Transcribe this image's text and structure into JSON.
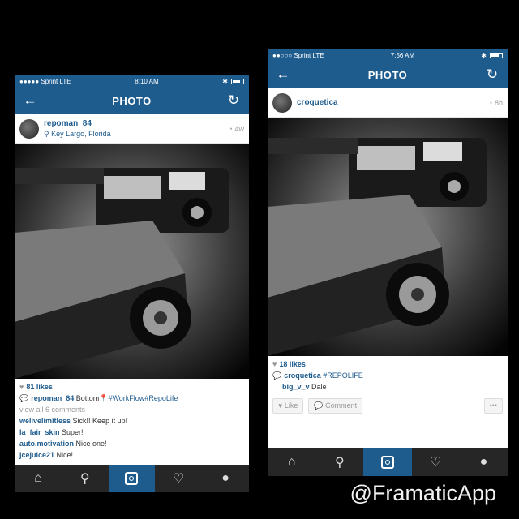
{
  "left": {
    "status": {
      "carrier": "●●●●● Sprint  LTE",
      "time": "8:10 AM",
      "bt": "✱"
    },
    "nav": {
      "title": "PHOTO",
      "back": "←",
      "refresh": "↻"
    },
    "post": {
      "username": "repoman_84",
      "location": "⚲ Key Largo, Florida",
      "time": "◔ 4w"
    },
    "likes": "81 likes",
    "caption": {
      "user": "repoman_84",
      "text": " Bottom📍",
      "tags": "#WorkFlow#RepoLife"
    },
    "view_all": "view all 6 comments",
    "comments": [
      {
        "user": "welivelimitless",
        "text": " Sick!! Keep it up!"
      },
      {
        "user": "la_fair_skin",
        "text": " Super!"
      },
      {
        "user": "auto.motivation",
        "text": " Nice one!"
      },
      {
        "user": "jcejuice21",
        "text": " Nice!"
      }
    ]
  },
  "right": {
    "status": {
      "carrier": "●●○○○ Sprint  LTE",
      "time": "7:56 AM",
      "bt": "✱"
    },
    "nav": {
      "title": "PHOTO",
      "back": "←",
      "refresh": "↻"
    },
    "post": {
      "username": "croquetica",
      "time": "◔ 8h"
    },
    "likes": "18 likes",
    "caption": {
      "user": "croquetica",
      "tags": " #REPOLIFE"
    },
    "comments": [
      {
        "user": "big_v_v",
        "text": " Dale"
      }
    ],
    "actions": {
      "like": "♥ Like",
      "comment": "💬 Comment",
      "more": "•••"
    }
  },
  "watermark": "@FramaticApp"
}
